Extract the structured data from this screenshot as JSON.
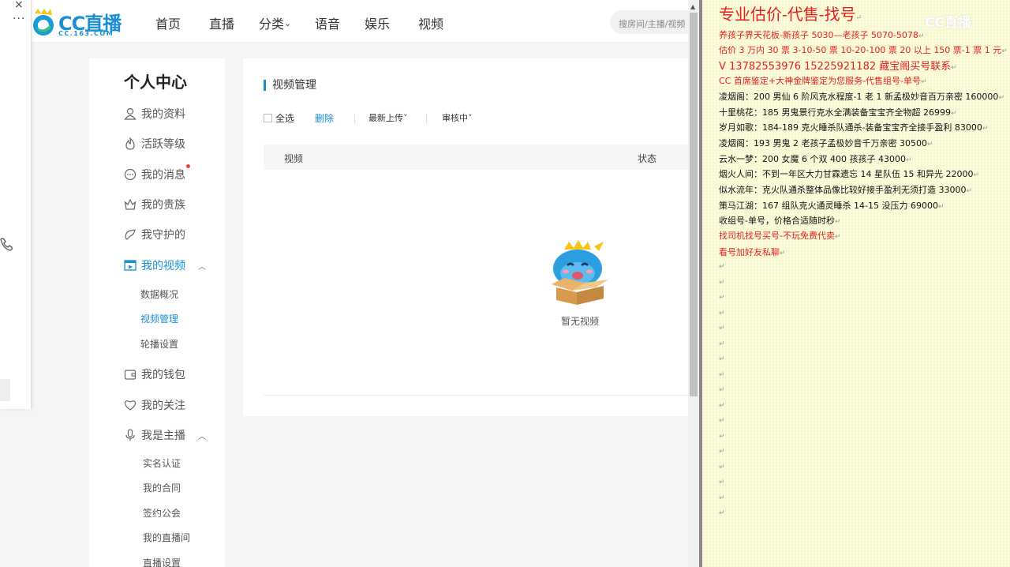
{
  "header": {
    "logo_text": "CC直播",
    "logo_sub": "CC.163.COM",
    "nav": [
      "首页",
      "直播",
      "分类",
      "语音",
      "娱乐",
      "视频"
    ],
    "nav_dropdown_caret": "⌄",
    "search_placeholder": "搜房间/主播/视频"
  },
  "left_panel": {
    "close_glyph": "×",
    "more_glyph": "···"
  },
  "sidebar": {
    "title": "个人中心",
    "items": [
      {
        "label": "我的资料",
        "icon": "user-icon"
      },
      {
        "label": "活跃等级",
        "icon": "flame-icon"
      },
      {
        "label": "我的消息",
        "icon": "message-icon",
        "badge_dot": true
      },
      {
        "label": "我的贵族",
        "icon": "crown-icon"
      },
      {
        "label": "我守护的",
        "icon": "guard-icon"
      },
      {
        "label": "我的视频",
        "icon": "video-icon",
        "active": true,
        "expanded": true
      },
      {
        "label": "我的钱包",
        "icon": "wallet-icon"
      },
      {
        "label": "我的关注",
        "icon": "heart-icon"
      },
      {
        "label": "我是主播",
        "icon": "mic-icon",
        "expanded": true
      }
    ],
    "video_sub": [
      "数据概况",
      "视频管理",
      "轮播设置"
    ],
    "anchor_sub": [
      "实名认证",
      "我的合同",
      "签约公会",
      "我的直播间",
      "直播设置"
    ],
    "active_sub": "视频管理",
    "expand_glyph": "︿"
  },
  "main": {
    "title": "视频管理",
    "select_all": "全选",
    "delete": "删除",
    "sort": "最新上传",
    "filter": "审核中",
    "caret": "˅",
    "columns": [
      "视频",
      "状态"
    ],
    "empty_text": "暂无视频"
  },
  "doc": {
    "watermark": "CC直播",
    "para_mark": "↵",
    "lines": [
      {
        "text": "专业估价-代售-找号",
        "style": "red big"
      },
      {
        "text": "养孩子界天花板-新孩子 5030—老孩子 5070-5078",
        "style": "red"
      },
      {
        "text": "估价 3 万内 30 票  3-10-50 票  10-20-100 票  20 以上 150 票-1 票 1 元",
        "style": "red"
      },
      {
        "text": "V 13782553976    15225921182   藏宝阁买号联系",
        "style": "red med"
      },
      {
        "text": "CC 首席鉴定+大神金牌鉴定为您服务-代售组号-单号",
        "style": "red"
      },
      {
        "text": "凌烟阁：200 男仙 6 阶风克水程度-1 老 1 新孟极妙音百万亲密 160000",
        "style": ""
      },
      {
        "text": "十里桃花：185 男鬼景行克水全满装备宝宝齐全物超 26999",
        "style": ""
      },
      {
        "text": "岁月如歌：184-189 克火睡杀队通杀-装备宝宝齐全接手盈利 83000",
        "style": ""
      },
      {
        "text": "凌烟阁：193 男鬼 2 老孩子孟极妙音千万亲密 30500",
        "style": ""
      },
      {
        "text": "云水一梦：200 女魔 6 个双 400 孩孩子 43000",
        "style": ""
      },
      {
        "text": "烟火人间：不到一年区大力甘霖遗忘 14 星队伍 15 和异光 22000",
        "style": ""
      },
      {
        "text": "似水流年：克火队通杀整体品像比较好接手盈利无须打造 33000",
        "style": ""
      },
      {
        "text": "策马江湖：167 组队克火通灵睡杀 14-15 没压力 69000",
        "style": ""
      },
      {
        "text": "收组号-单号，价格合适随时秒",
        "style": ""
      },
      {
        "text": "找司机找号买号-不玩免费代卖",
        "style": "red"
      },
      {
        "text": "看号加好友私聊",
        "style": "red"
      }
    ],
    "empty_marks": 17
  },
  "colors": {
    "accent": "#1a8fd6",
    "doc_red": "#e21f1f",
    "doc_bg": "#fbfbdc"
  }
}
